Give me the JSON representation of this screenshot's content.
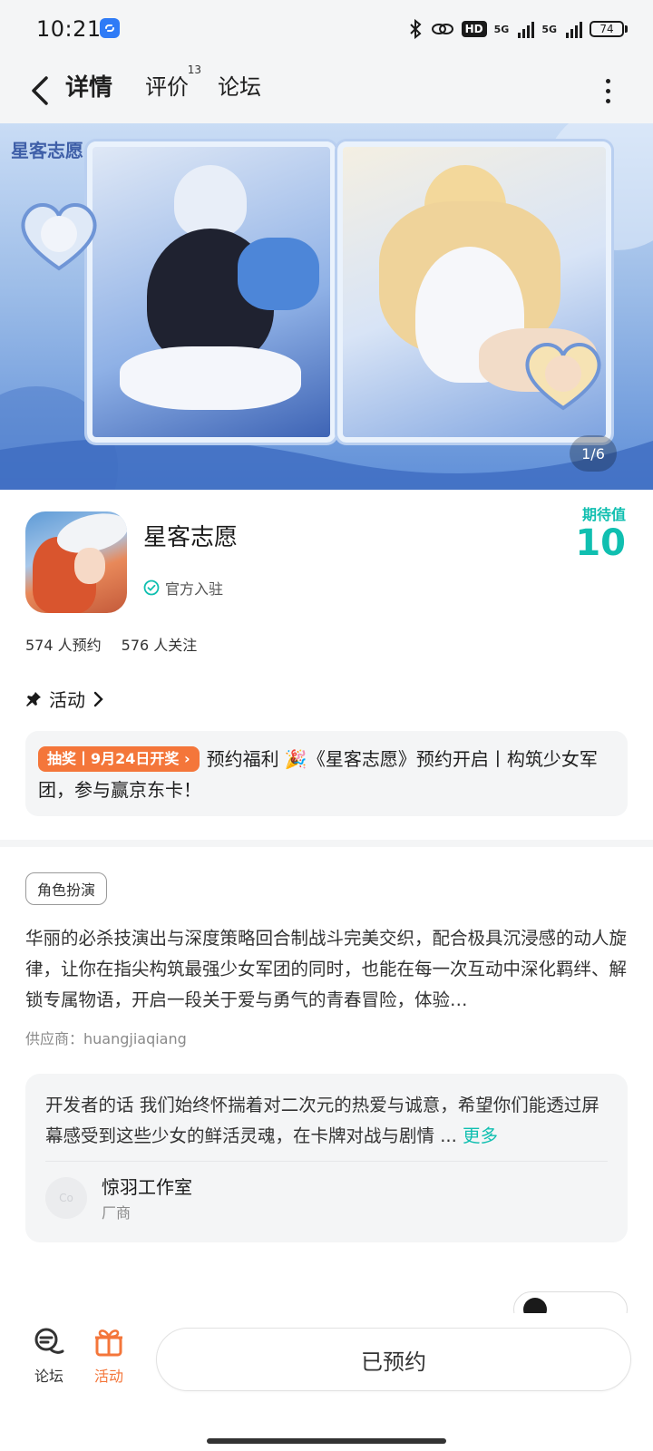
{
  "status_bar": {
    "time": "10:21",
    "network_1": "5G",
    "network_2": "5G",
    "hd_label": "HD",
    "battery": "74"
  },
  "nav": {
    "tabs": [
      {
        "label": "详情",
        "active": true
      },
      {
        "label": "评价",
        "badge": "13"
      },
      {
        "label": "论坛"
      }
    ]
  },
  "banner": {
    "title": "星客志愿",
    "page_indicator": "1/6"
  },
  "game": {
    "name": "星客志愿",
    "official_label": "官方入驻",
    "expectation_label": "期待值",
    "expectation_value": "10",
    "reservations": "574 人预约",
    "followers": "576 人关注"
  },
  "activity": {
    "header": "活动",
    "tag": "抽奖丨9月24日开奖",
    "text": "预约福利 🎉《星客志愿》预约开启丨构筑少女军团，参与赢京东卡！"
  },
  "about": {
    "genre": "角色扮演",
    "description": "华丽的必杀技演出与深度策略回合制战斗完美交织，配合极具沉浸感的动人旋律，让你在指尖构筑最强少女军团的同时，也能在每一次互动中深化羁绊、解锁专属物语，开启一段关于爱与勇气的青春冒险，体验…",
    "supplier": "供应商：huangjiaqiang"
  },
  "developer": {
    "words": "开发者的话  我们始终怀揣着对二次元的热爱与诚意，希望你们能透过屏幕感受到这些少女的鲜活灵魂，在卡牌对战与剧情 ...",
    "more_label": "更多",
    "avatar_text": "Co",
    "name": "惊羽工作室",
    "role": "厂商"
  },
  "bottom": {
    "forum_label": "论坛",
    "activity_label": "活动",
    "reserve_button": "已预约"
  },
  "colors": {
    "accent": "#10bfb0",
    "orange": "#f4763a",
    "background_gray": "#f4f5f6"
  }
}
